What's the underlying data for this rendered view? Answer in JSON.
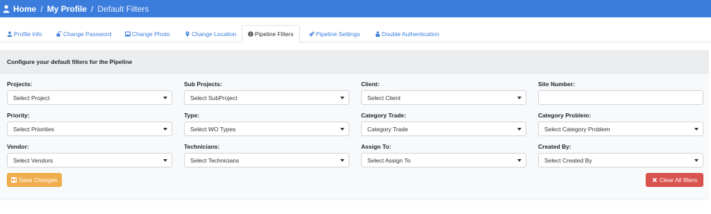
{
  "breadcrumb": {
    "home": "Home",
    "profile": "My Profile",
    "current": "Default Filters",
    "separator": "/"
  },
  "tabs": [
    {
      "label": "Profile Info",
      "icon": "user-icon"
    },
    {
      "label": "Change Password",
      "icon": "unlock-icon"
    },
    {
      "label": "Change Photo",
      "icon": "image-icon"
    },
    {
      "label": "Change Location",
      "icon": "map-marker-icon"
    },
    {
      "label": "Pipeline Filters",
      "icon": "info-circle-icon",
      "active": true
    },
    {
      "label": "Pipeline Settings",
      "icon": "gears-icon"
    },
    {
      "label": "Double Authentication",
      "icon": "lock-user-icon"
    }
  ],
  "panel": {
    "heading": "Configure your default filters for the Pipeline",
    "fields": [
      {
        "label": "Projects:",
        "value": "Select Project",
        "type": "select"
      },
      {
        "label": "Sub Projects:",
        "value": "Select SubProject",
        "type": "select"
      },
      {
        "label": "Client:",
        "value": "Select Client",
        "type": "select"
      },
      {
        "label": "Site Number:",
        "value": "",
        "type": "text"
      },
      {
        "label": "Priority:",
        "value": "Select Priorities",
        "type": "select"
      },
      {
        "label": "Type:",
        "value": "Select WO Types",
        "type": "select"
      },
      {
        "label": "Category Trade:",
        "value": "Category Trade",
        "type": "select"
      },
      {
        "label": "Category Problem:",
        "value": "Select Category Problem",
        "type": "select"
      },
      {
        "label": "Vendor:",
        "value": "Select Vendors",
        "type": "select"
      },
      {
        "label": "Technicians:",
        "value": "Select Technicians",
        "type": "select"
      },
      {
        "label": "Assign To:",
        "value": "Select Assign To",
        "type": "select"
      },
      {
        "label": "Created By:",
        "value": "Select Created By",
        "type": "select"
      }
    ],
    "save_label": "Save Changes",
    "clear_label": "Clear All filters"
  },
  "colors": {
    "accent": "#3b7ddd",
    "warning": "#f0ad4e",
    "danger": "#d9534f"
  }
}
